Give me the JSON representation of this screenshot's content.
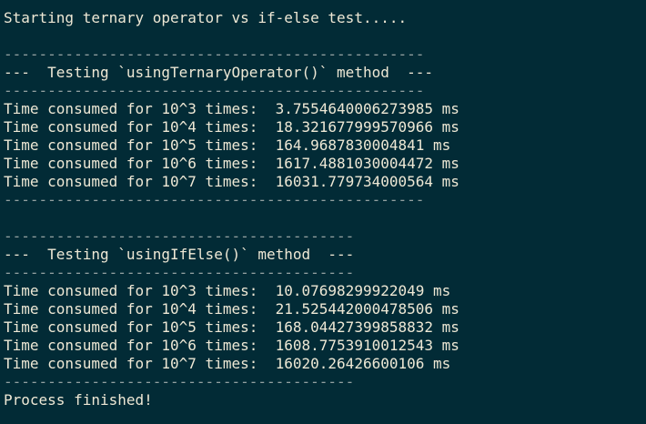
{
  "terminal": {
    "start_message": "Starting ternary operator vs if-else test.....",
    "divider_long": "------------------------------------------------",
    "divider_short": "----------------------------------------",
    "sections": [
      {
        "heading": "---  Testing `usingTernaryOperator()` method  ---",
        "rows": [
          "Time consumed for 10^3 times:  3.7554640006273985 ms",
          "Time consumed for 10^4 times:  18.321677999570966 ms",
          "Time consumed for 10^5 times:  164.9687830004841 ms",
          "Time consumed for 10^6 times:  1617.4881030004472 ms",
          "Time consumed for 10^7 times:  16031.779734000564 ms"
        ]
      },
      {
        "heading": "---  Testing `usingIfElse()` method  ---",
        "rows": [
          "Time consumed for 10^3 times:  10.07698299922049 ms",
          "Time consumed for 10^4 times:  21.525442000478506 ms",
          "Time consumed for 10^5 times:  168.04427399858832 ms",
          "Time consumed for 10^6 times:  1608.7753910012543 ms",
          "Time consumed for 10^7 times:  16020.26426600106 ms"
        ]
      }
    ],
    "end_message": "Process finished!"
  }
}
